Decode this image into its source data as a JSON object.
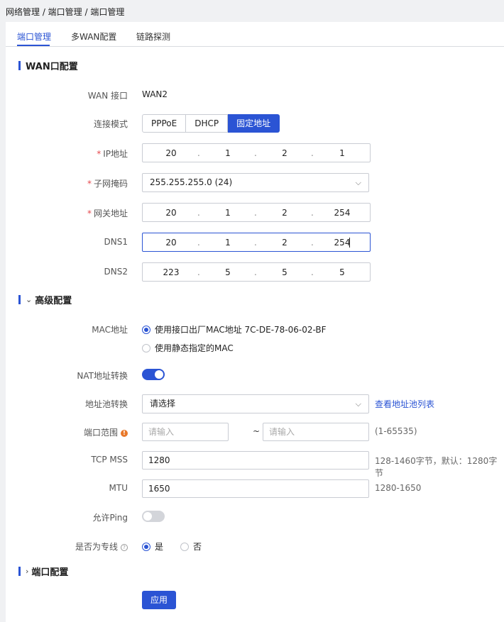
{
  "breadcrumb": "网络管理 / 端口管理 / 端口管理",
  "tabs": [
    {
      "label": "端口管理",
      "active": true
    },
    {
      "label": "多WAN配置",
      "active": false
    },
    {
      "label": "链路探测",
      "active": false
    }
  ],
  "wan_section": {
    "title": "WAN口配置",
    "wan_label": "WAN 接口",
    "wan_value": "WAN2",
    "mode_label": "连接模式",
    "modes": [
      "PPPoE",
      "DHCP",
      "固定地址"
    ],
    "selected_mode": "固定地址",
    "ip": {
      "label": "IP地址",
      "octets": [
        "20",
        "1",
        "2",
        "1"
      ]
    },
    "mask": {
      "label": "子网掩码",
      "value": "255.255.255.0 (24)"
    },
    "gateway": {
      "label": "网关地址",
      "octets": [
        "20",
        "1",
        "2",
        "254"
      ]
    },
    "dns1": {
      "label": "DNS1",
      "octets": [
        "20",
        "1",
        "2",
        "254"
      ]
    },
    "dns2": {
      "label": "DNS2",
      "octets": [
        "223",
        "5",
        "5",
        "5"
      ]
    },
    "required_mark": "*",
    "dot": "."
  },
  "advanced_section": {
    "title": "高级配置",
    "mac": {
      "label": "MAC地址",
      "option_factory": "使用接口出厂MAC地址 7C-DE-78-06-02-BF",
      "option_static": "使用静态指定的MAC"
    },
    "nat": {
      "label": "NAT地址转换",
      "enabled": true
    },
    "pool": {
      "label": "地址池转换",
      "placeholder": "请选择",
      "link": "查看地址池列表"
    },
    "port_range": {
      "label": "端口范围",
      "from_placeholder": "请输入",
      "to_placeholder": "请输入",
      "separator": "~",
      "hint": "(1-65535)"
    },
    "tcp_mss": {
      "label": "TCP MSS",
      "value": "1280",
      "hint": "128-1460字节，默认：1280字节"
    },
    "mtu": {
      "label": "MTU",
      "value": "1650",
      "hint": "1280-1650"
    },
    "ping": {
      "label": "允许Ping",
      "enabled": false
    },
    "dedicated": {
      "label": "是否为专线",
      "yes": "是",
      "no": "否",
      "selected": "是"
    }
  },
  "port_section": {
    "title": "端口配置"
  },
  "apply_label": "应用",
  "icons": {
    "warn": "!",
    "help": "?",
    "chevron_down": "⌄",
    "chevron_right": "›",
    "dropdown_arrow": "⌵"
  },
  "colors": {
    "accent": "#2b54d4",
    "required": "#e5484d",
    "warning": "#e8782a"
  }
}
